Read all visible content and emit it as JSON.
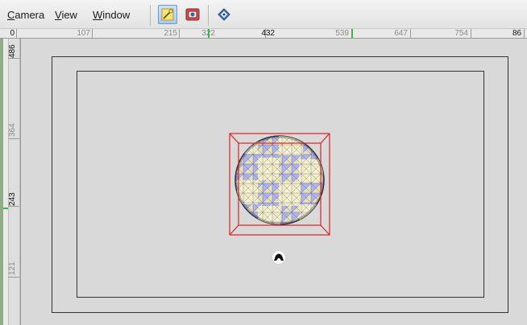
{
  "menu": {
    "camera": "Camera",
    "view": "View",
    "window": "Window"
  },
  "toolbar": {
    "buttons": [
      {
        "name": "select-move-tool",
        "icon": "wand-icon",
        "active": true
      },
      {
        "name": "render-tool",
        "icon": "render-icon",
        "active": false
      },
      {
        "name": "navigate-tool",
        "icon": "diamond-nav-icon",
        "active": false
      }
    ]
  },
  "ruler_h": {
    "labels": [
      "0",
      "107",
      "215",
      "322",
      "432",
      "539",
      "647",
      "754",
      "86"
    ]
  },
  "ruler_v": {
    "labels": [
      "486",
      "364",
      "243",
      "121"
    ]
  },
  "viewport": {
    "object": "sphere",
    "selection_color": "#e02020",
    "mesh_color_a": "#a9b1ef",
    "mesh_color_b": "#ece6b8"
  }
}
